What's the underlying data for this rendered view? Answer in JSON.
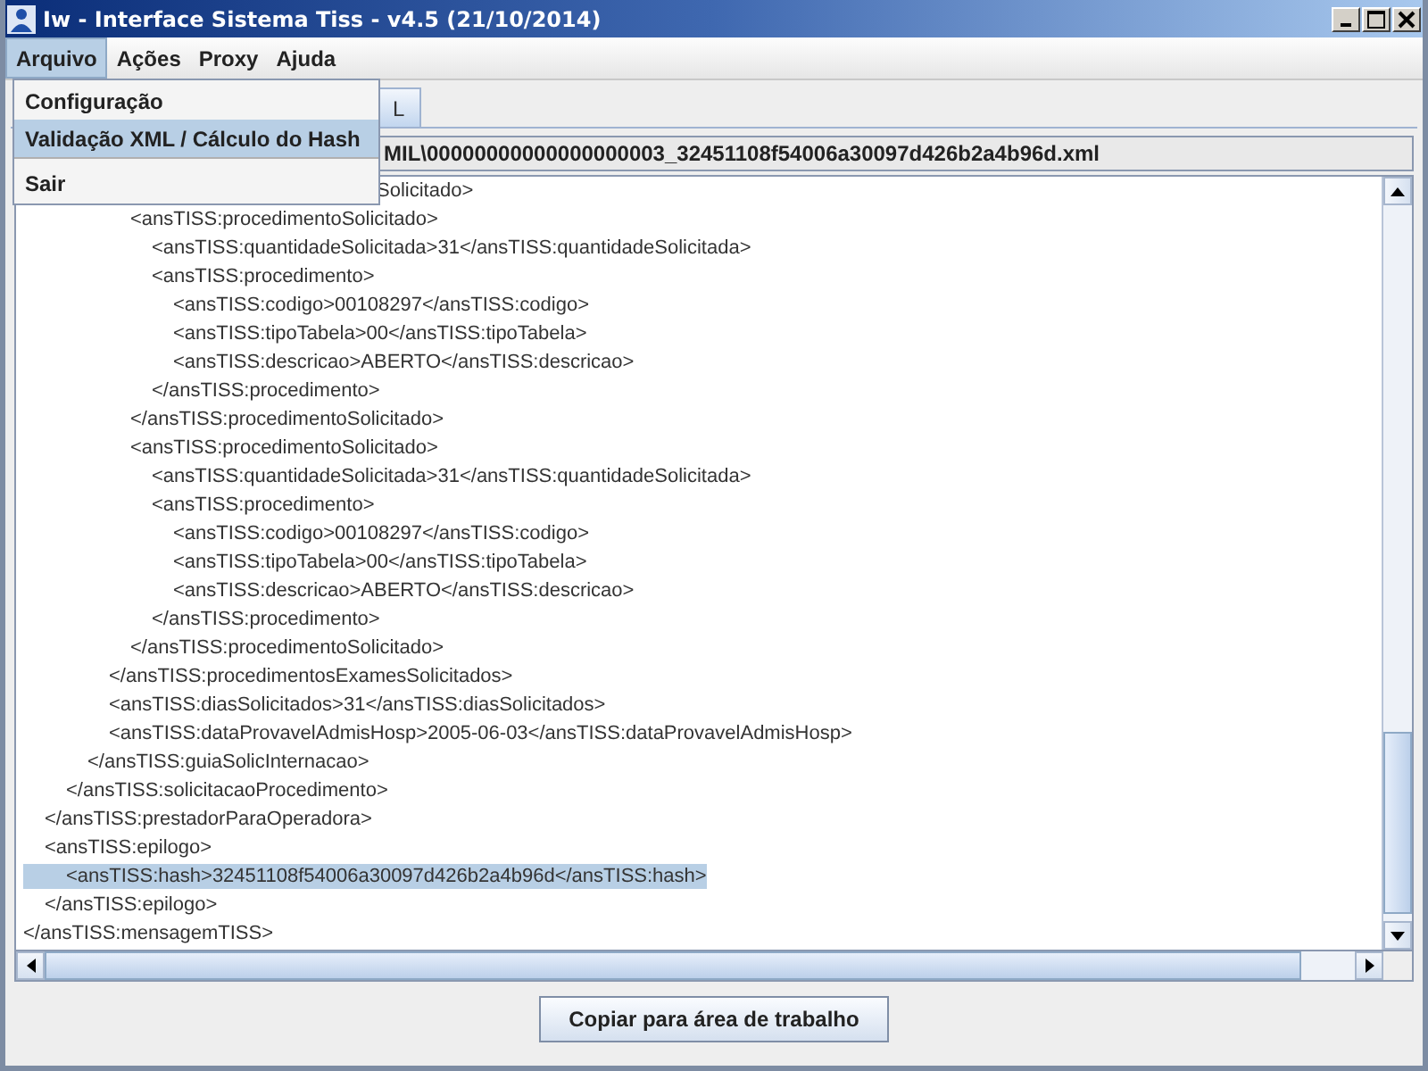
{
  "window": {
    "title": "Iw - Interface Sistema Tiss - v4.5 (21/10/2014)"
  },
  "menu_bar": [
    {
      "label": "Arquivo",
      "selected": true
    },
    {
      "label": "Ações",
      "selected": false
    },
    {
      "label": "Proxy",
      "selected": false
    },
    {
      "label": "Ajuda",
      "selected": false
    }
  ],
  "open_menu": {
    "items": [
      {
        "label": "Configuração",
        "selected": false,
        "separator_after": false
      },
      {
        "label": "Validação XML / Cálculo do Hash",
        "selected": true,
        "separator_after": true
      },
      {
        "label": "Sair",
        "selected": false,
        "separator_after": false
      }
    ]
  },
  "tabs": [
    {
      "label": "L",
      "selected": true
    }
  ],
  "file_path": "MIL\\00000000000000000003_32451108f54006a30097d426b2a4b96d.xml",
  "xml_view": {
    "lines": [
      {
        "children": [
          {
            "children": [
              {
                "children": [
                  {
                    "children": [
                      {
                        "children": [
                          {
                            "text": "Solicitado>",
                            "selected": false,
                            "kind": "covered"
                          },
                          {
                            "text": "<ansTISS:procedimentoSolicitado>",
                            "selected": false,
                            "children": [
                              {
                                "text": "<ansTISS:quantidadeSolicitada>31</ansTISS:quantidadeSolicitada>",
                                "selected": false
                              },
                              {
                                "text": "<ansTISS:procedimento>",
                                "selected": false,
                                "children": [
                                  {
                                    "text": "<ansTISS:codigo>00108297</ansTISS:codigo>",
                                    "selected": false
                                  },
                                  {
                                    "text": "<ansTISS:tipoTabela>00</ansTISS:tipoTabela>",
                                    "selected": false
                                  },
                                  {
                                    "text": "<ansTISS:descricao>ABERTO</ansTISS:descricao>",
                                    "selected": false
                                  }
                                ]
                              },
                              {
                                "text": "</ansTISS:procedimento>",
                                "selected": false
                              }
                            ]
                          },
                          {
                            "text": "</ansTISS:procedimentoSolicitado>",
                            "selected": false
                          },
                          {
                            "text": "<ansTISS:procedimentoSolicitado>",
                            "selected": false,
                            "children": [
                              {
                                "text": "<ansTISS:quantidadeSolicitada>31</ansTISS:quantidadeSolicitada>",
                                "selected": false
                              },
                              {
                                "text": "<ansTISS:procedimento>",
                                "selected": false,
                                "children": [
                                  {
                                    "text": "<ansTISS:codigo>00108297</ansTISS:codigo>",
                                    "selected": false
                                  },
                                  {
                                    "text": "<ansTISS:tipoTabela>00</ansTISS:tipoTabela>",
                                    "selected": false
                                  },
                                  {
                                    "text": "<ansTISS:descricao>ABERTO</ansTISS:descricao>",
                                    "selected": false
                                  }
                                ]
                              },
                              {
                                "text": "</ansTISS:procedimento>",
                                "selected": false
                              }
                            ]
                          },
                          {
                            "text": "</ansTISS:procedimentoSolicitado>",
                            "selected": false
                          }
                        ]
                      },
                      {
                        "text": "</ansTISS:procedimentosExamesSolicitados>",
                        "selected": false
                      },
                      {
                        "text": "<ansTISS:diasSolicitados>31</ansTISS:diasSolicitados>",
                        "selected": false
                      },
                      {
                        "text": "<ansTISS:dataProvavelAdmisHosp>2005-06-03</ansTISS:dataProvavelAdmisHosp>",
                        "selected": false
                      }
                    ]
                  },
                  {
                    "text": "</ansTISS:guiaSolicInternacao>",
                    "selected": false
                  }
                ]
              },
              {
                "text": "</ansTISS:solicitacaoProcedimento>",
                "selected": false
              }
            ]
          },
          {
            "text": "</ansTISS:prestadorParaOperadora>",
            "selected": false
          },
          {
            "text": "<ansTISS:epilogo>",
            "selected": false,
            "children": [
              {
                "text": "<ansTISS:hash>32451108f54006a30097d426b2a4b96d</ansTISS:hash>",
                "selected": true
              }
            ]
          },
          {
            "text": "</ansTISS:epilogo>",
            "selected": false
          }
        ]
      },
      {
        "text": "</ansTISS:mensagemTISS>",
        "selected": false
      }
    ]
  },
  "buttons": [
    {
      "label": "Copiar para área de trabalho"
    }
  ]
}
